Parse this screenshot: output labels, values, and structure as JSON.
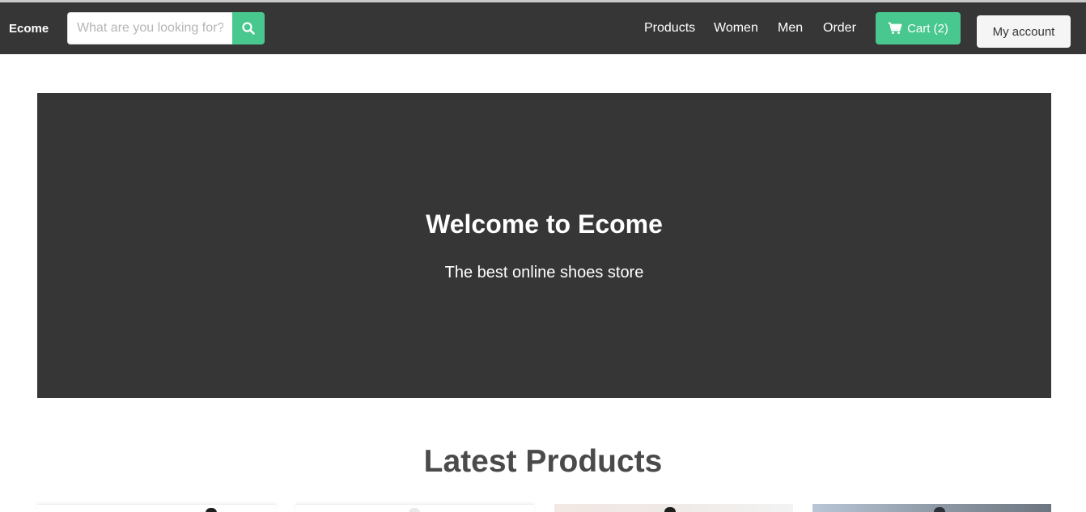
{
  "header": {
    "brand": "Ecome",
    "search": {
      "placeholder": "What are you looking for?",
      "value": ""
    },
    "nav": [
      "Products",
      "Women",
      "Men",
      "Order"
    ],
    "cart_label": "Cart (2)",
    "account_label": "My account"
  },
  "hero": {
    "title": "Welcome to Ecome",
    "subtitle": "The best online shoes store"
  },
  "latest": {
    "title": "Latest Products"
  },
  "colors": {
    "navbar": "#363636",
    "accent": "#48c78e",
    "hero": "#363636",
    "light_button": "#f5f5f5"
  },
  "icons": {
    "search": "search-icon",
    "cart": "shopping-cart-icon"
  }
}
